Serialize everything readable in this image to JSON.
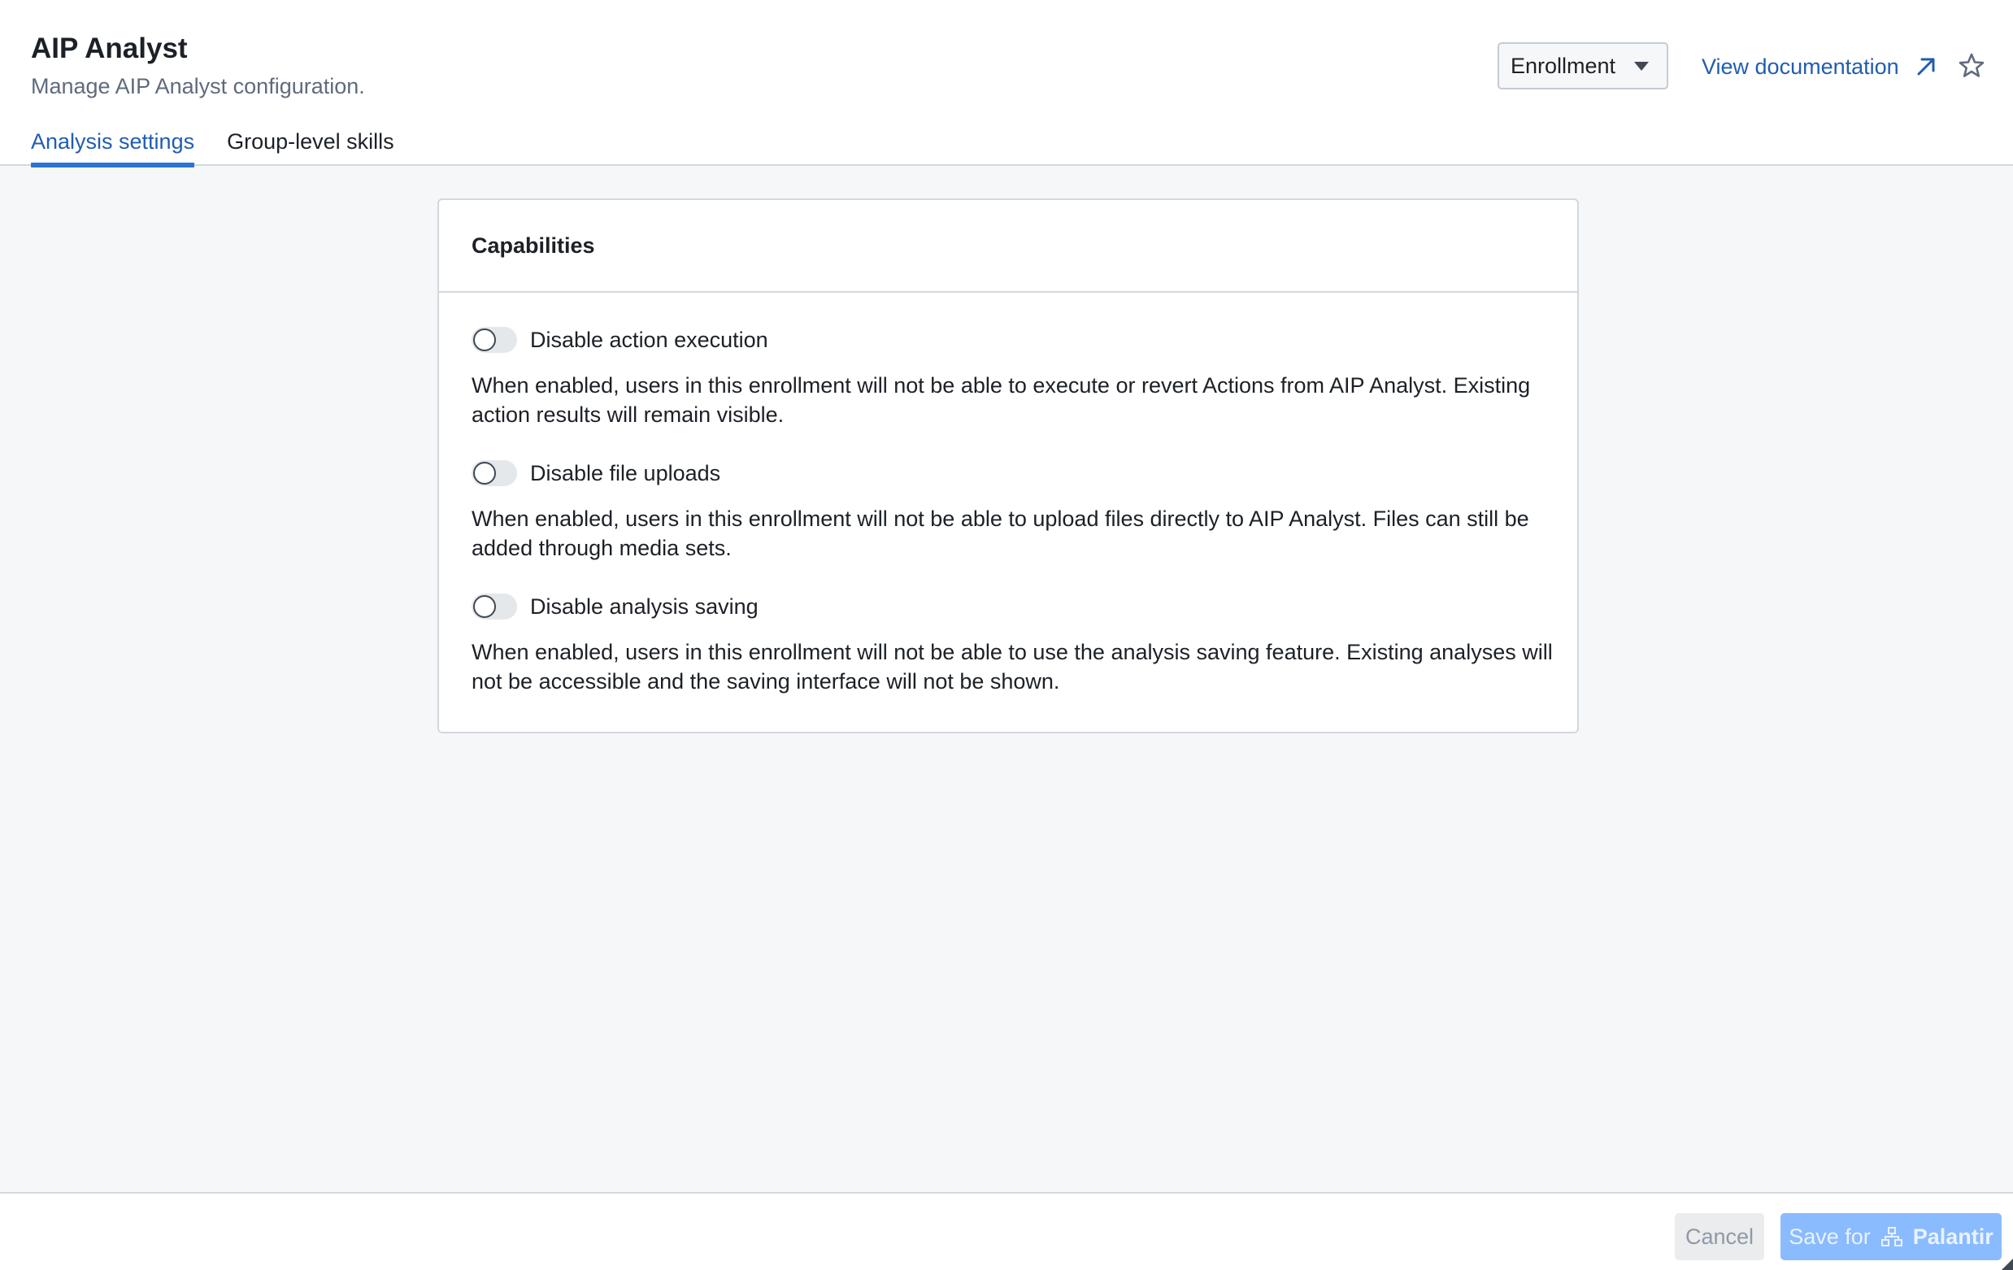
{
  "header": {
    "title": "AIP Analyst",
    "subtitle": "Manage AIP Analyst configuration.",
    "tabs": [
      {
        "label": "Analysis settings",
        "active": true
      },
      {
        "label": "Group-level skills",
        "active": false
      }
    ],
    "scope_select": {
      "value": "Enrollment"
    },
    "doc_link": {
      "label": "View documentation",
      "icon": "external-link-icon"
    },
    "favorite_icon": "star-icon"
  },
  "card": {
    "title": "Capabilities",
    "settings": [
      {
        "label": "Disable action execution",
        "enabled": false,
        "description": "When enabled, users in this enrollment will not be able to execute or revert Actions from AIP Analyst. Existing action results will remain visible."
      },
      {
        "label": "Disable file uploads",
        "enabled": false,
        "description": "When enabled, users in this enrollment will not be able to upload files directly to AIP Analyst. Files can still be added through media sets."
      },
      {
        "label": "Disable analysis saving",
        "enabled": false,
        "description": "When enabled, users in this enrollment will not be able to use the analysis saving feature. Existing analyses will not be accessible and the saving interface will not be shown."
      }
    ]
  },
  "footer": {
    "cancel_label": "Cancel",
    "save_prefix": "Save for",
    "save_org": "Palantir",
    "save_icon": "organization-icon"
  },
  "colors": {
    "accent": "#2d72d2",
    "link": "#215db0",
    "save_button": "#8abbff",
    "background": "#f6f7f9"
  }
}
